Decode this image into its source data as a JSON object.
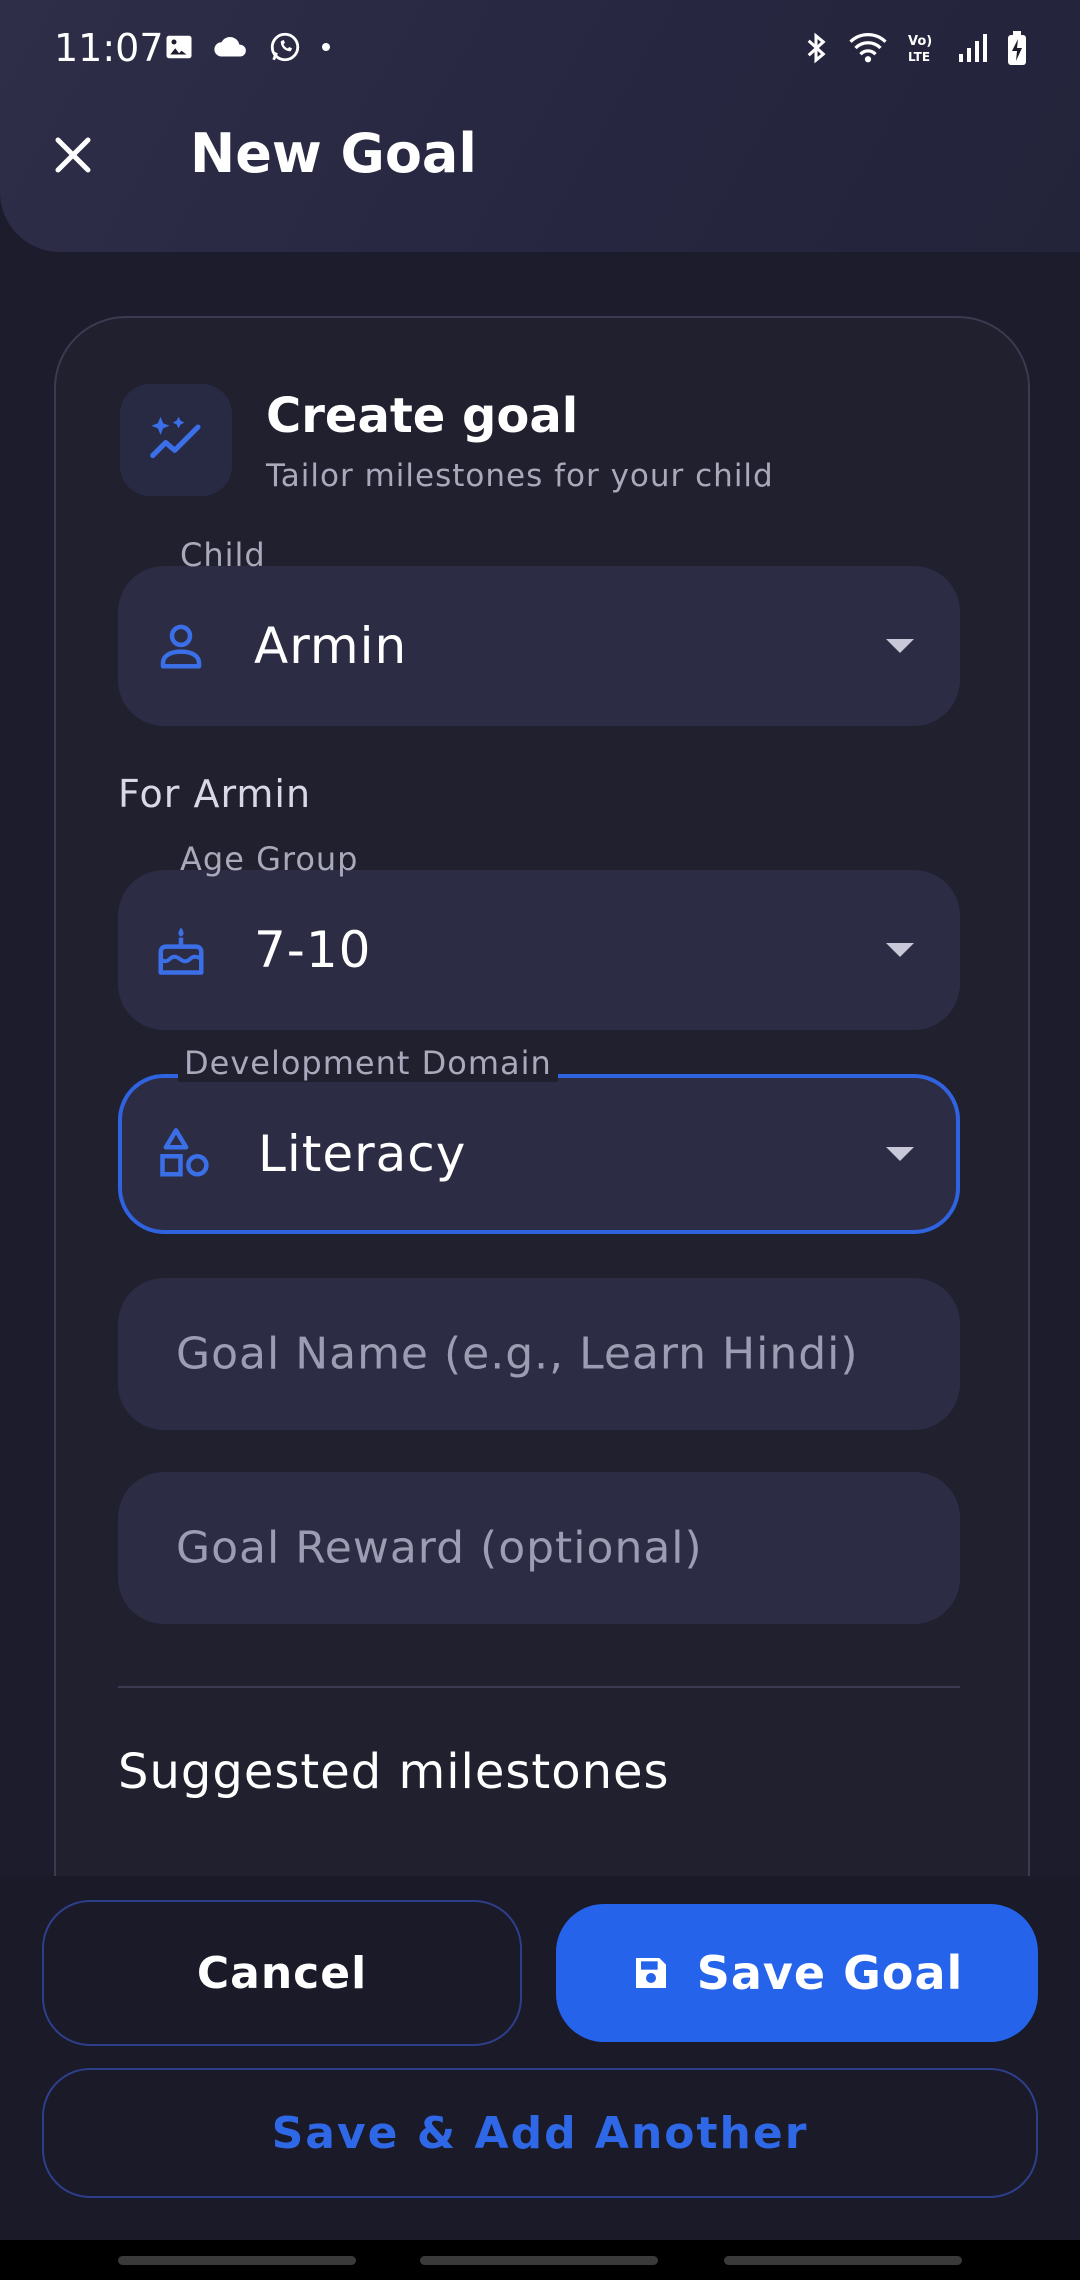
{
  "status_bar": {
    "time": "11:07",
    "left_icons": [
      "image-icon",
      "cloud-icon",
      "whatsapp-icon",
      "dot-icon"
    ],
    "right_icons": [
      "bluetooth-icon",
      "wifi-icon",
      "volte-icon",
      "signal-icon",
      "battery-charging-icon"
    ],
    "volte_text": "Vo) LTE"
  },
  "header": {
    "title": "New Goal",
    "close_icon": "close-icon"
  },
  "card": {
    "icon": "sparkles-trend-icon",
    "title": "Create goal",
    "subtitle": "Tailor milestones for your child"
  },
  "fields": {
    "child": {
      "label": "Child",
      "value": "Armin",
      "icon": "person-icon"
    },
    "section_label": "For Armin",
    "age_group": {
      "label": "Age Group",
      "value": "7-10",
      "icon": "cake-icon"
    },
    "domain": {
      "label": "Development Domain",
      "value": "Literacy",
      "icon": "shapes-icon"
    },
    "goal_name": {
      "placeholder": "Goal Name (e.g., Learn Hindi)"
    },
    "goal_reward": {
      "placeholder": "Goal Reward (optional)"
    }
  },
  "milestones": {
    "title": "Suggested milestones"
  },
  "actions": {
    "cancel": "Cancel",
    "save": "Save Goal",
    "save_icon": "save-icon",
    "save_another": "Save & Add Another"
  },
  "colors": {
    "accent": "#2563eb",
    "background": "#1c1c2c",
    "field_bg": "#2c2c44",
    "icon_blue": "#3b6fe8"
  }
}
